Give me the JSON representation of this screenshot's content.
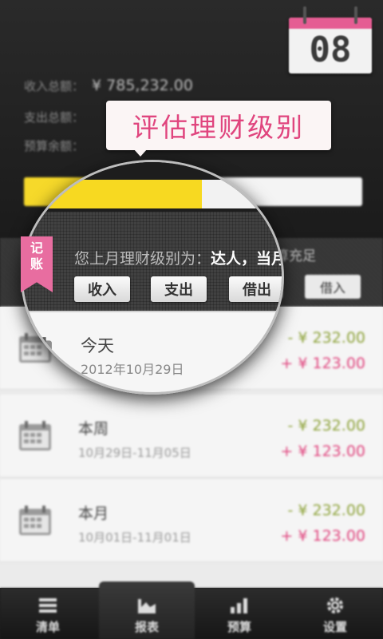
{
  "header": {
    "income_label": "收入总额：",
    "income_value": "¥ 785,232.00",
    "expense_label": "支出总额：",
    "budget_label": "预算余额：",
    "calendar_day": "08",
    "budget_progress_percent": 52
  },
  "tooltip": {
    "text": "评估理财级别"
  },
  "notice": {
    "prefix": "您上月理财级别为：",
    "level": "达人，",
    "suffix": "当月预算充足"
  },
  "ribbon": {
    "char1": "记",
    "char2": "账"
  },
  "actions": [
    {
      "label": "收入"
    },
    {
      "label": "支出"
    },
    {
      "label": "借出"
    },
    {
      "label": "借入"
    }
  ],
  "records": [
    {
      "title": "今天",
      "date": "2012年10月29日",
      "expense": "- ¥ 232.00",
      "income": "+ ¥ 123.00"
    },
    {
      "title": "本周",
      "date": "10月29日-11月05日",
      "expense": "- ¥ 232.00",
      "income": "+ ¥ 123.00"
    },
    {
      "title": "本月",
      "date": "10月01日-11月01日",
      "expense": "- ¥ 232.00",
      "income": "+ ¥ 123.00"
    }
  ],
  "nav": [
    {
      "label": "清单",
      "icon": "list-icon"
    },
    {
      "label": "报表",
      "icon": "chart-icon"
    },
    {
      "label": "预算",
      "icon": "bar-chart-icon"
    },
    {
      "label": "设置",
      "icon": "gear-icon"
    }
  ],
  "colors": {
    "accent_pink": "#e0457e",
    "progress_yellow": "#f6d92a",
    "expense_green": "#8ea33b"
  }
}
